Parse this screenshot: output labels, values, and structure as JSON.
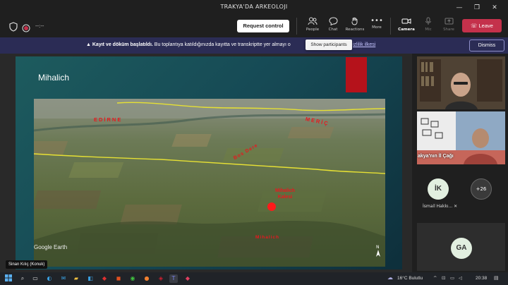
{
  "window": {
    "title": "TRAKYA'DA ARKEOLOJI",
    "minimize": "—",
    "restore": "❐",
    "close": "✕"
  },
  "toolbar": {
    "timer": "--:--",
    "request_control": "Request control",
    "people": "People",
    "chat": "Chat",
    "reactions": "Reactions",
    "more": "More",
    "camera": "Camera",
    "mic": "Mic",
    "share": "Share",
    "leave": "Leave",
    "tooltip": "Show participants"
  },
  "banner": {
    "bold": "Kayıt ve döküm başlatıldı.",
    "text": "Bu toplantıya katıldığınızda kayıtta ve transkriptte yer almayı o",
    "link": "izlilik ilkesi",
    "dismiss": "Dismiss"
  },
  "slide": {
    "title": "Mihalich",
    "labels": {
      "edirne": "EDİRNE",
      "meric": "MERİÇ",
      "bosdere": "Bos Dere",
      "mihalich_kalesi_1": "Mihalich",
      "mihalich_kalesi_2": "Kalesi",
      "mihalich": "Mihalich",
      "google_earth": "Google Earth"
    }
  },
  "presenter_tag": "Sinan Kılıç (Konuk)",
  "gallery": {
    "thumb_caption": "akya'nın İl       Çağı",
    "avatar1": "İK",
    "avatar1_name": "İsmail Hakkı...",
    "overflow": "+26",
    "avatar2": "GA"
  },
  "taskbar": {
    "weather": "16°C  Bulutlu",
    "time": "20:38"
  },
  "colors": {
    "leave": "#c4314b",
    "banner": "#2b2c55",
    "accent_red": "#b5121b"
  }
}
